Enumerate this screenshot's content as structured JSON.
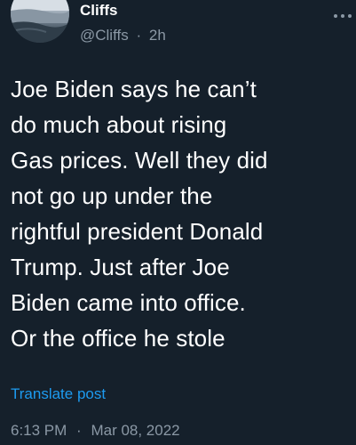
{
  "author": {
    "display_name": "Cliffs",
    "handle": "@Cliffs",
    "separator": "·",
    "relative_time": "2h"
  },
  "tweet": {
    "text": "Joe Biden says he can’t\ndo much about rising\nGas prices. Well they did\nnot go up under the\nrightful president Donald\nTrump. Just after Joe\nBiden came into office.\nOr the office he stole",
    "translate_label": "Translate post",
    "time": "6:13 PM",
    "time_separator": "·",
    "date": "Mar 08, 2022"
  },
  "icons": {
    "avatar": "profile-avatar",
    "more": "more-options-icon"
  },
  "colors": {
    "background": "#15202b",
    "primary_text": "#ffffff",
    "secondary_text": "#8b98a5",
    "link": "#1d9bf0"
  }
}
